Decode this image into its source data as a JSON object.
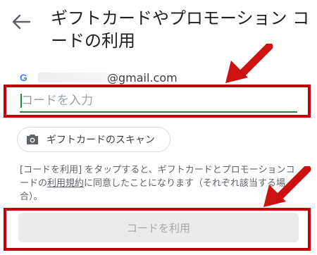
{
  "header": {
    "title": "ギフトカードやプロモーション コードの利用"
  },
  "account": {
    "email_domain": "@gmail.com",
    "provider_letter": "G"
  },
  "code_input": {
    "placeholder": "コードを入力",
    "value": ""
  },
  "scan_button": {
    "label": "ギフトカードのスキャン"
  },
  "terms": {
    "before_link": "[コードを利用] をタップすると、ギフトカードとプロモーションコードの",
    "link": "利用規約",
    "after_link": "に同意したことになります（それぞれ該当する場合）。"
  },
  "redeem_button": {
    "label": "コードを利用"
  },
  "colors": {
    "highlight": "#c0000a",
    "focus_underline": "#1e8e3e",
    "arrow": "#cc1111"
  },
  "icons": {
    "back": "arrow-left-icon",
    "camera": "camera-icon",
    "google": "google-g-icon"
  }
}
